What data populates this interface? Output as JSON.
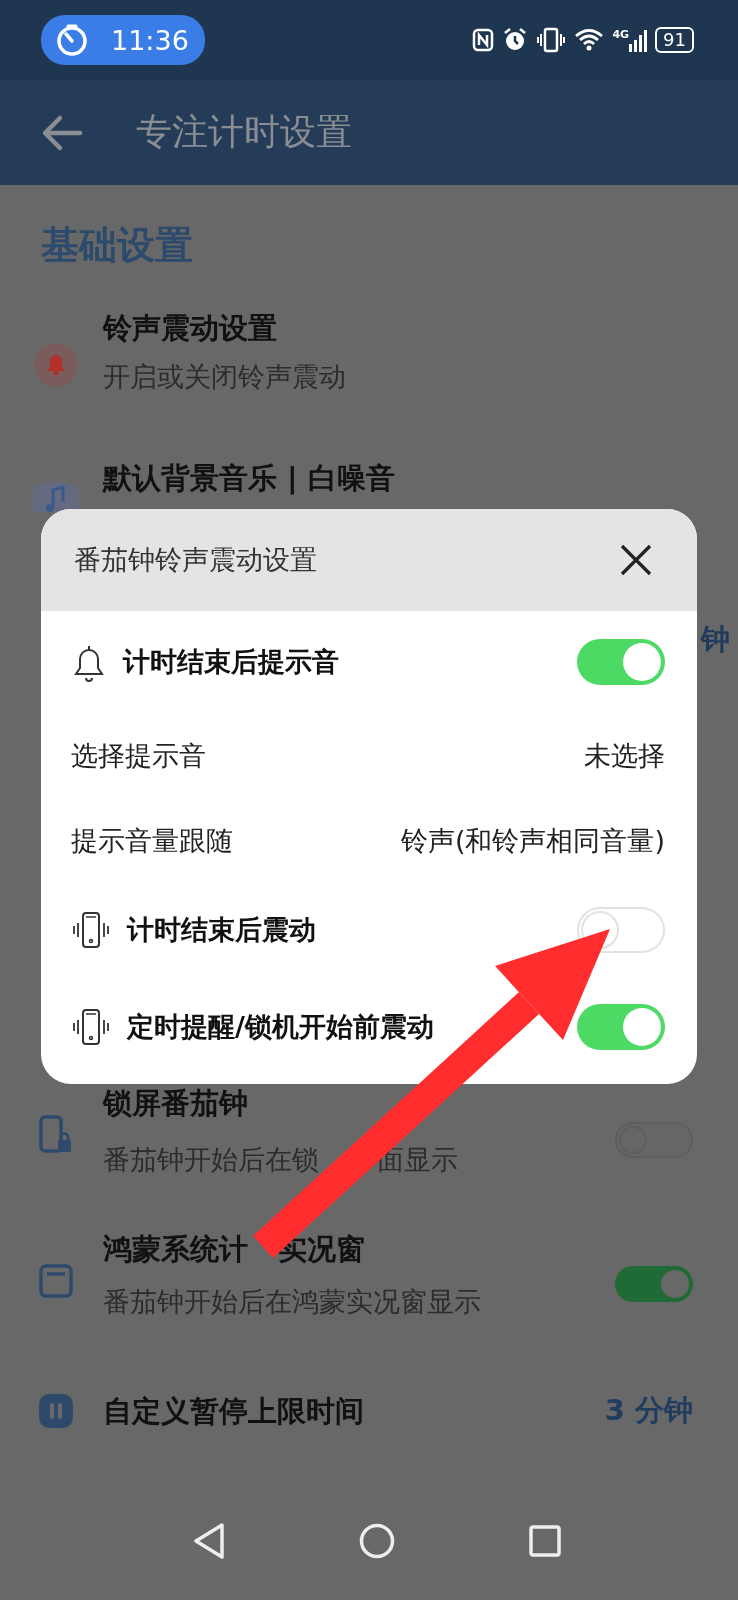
{
  "status_bar": {
    "time": "11:36",
    "network": "4G",
    "battery": "91"
  },
  "header": {
    "title": "专注计时设置"
  },
  "section_title": "基础设置",
  "settings": [
    {
      "kind": "link",
      "title": "铃声震动设置",
      "subtitle": "开启或关闭铃声震动"
    },
    {
      "kind": "link",
      "title": "默认背景音乐 | 白噪音"
    },
    {
      "kind": "value",
      "value": "钟"
    },
    {
      "kind": "toggle",
      "title": "锁屏番茄钟",
      "subtitle_parts": [
        "番茄钟开始后在锁",
        "面显示"
      ],
      "on": false
    },
    {
      "kind": "toggle",
      "title_parts": [
        "鸿蒙系统计",
        "实况窗"
      ],
      "subtitle": "番茄钟开始后在鸿蒙实况窗显示",
      "on": true
    },
    {
      "kind": "value",
      "title": "自定义暂停上限时间",
      "value": "3 分钟"
    }
  ],
  "dialog": {
    "title": "番茄钟铃声震动设置",
    "rows": [
      {
        "kind": "toggle",
        "label": "计时结束后提示音",
        "on": true
      },
      {
        "kind": "value",
        "label": "选择提示音",
        "value": "未选择"
      },
      {
        "kind": "value",
        "label": "提示音量跟随",
        "value": "铃声(和铃声相同音量)"
      },
      {
        "kind": "toggle",
        "label": "计时结束后震动",
        "on": false
      },
      {
        "kind": "toggle",
        "label": "定时提醒/锁机开始前震动",
        "on": true
      }
    ]
  }
}
